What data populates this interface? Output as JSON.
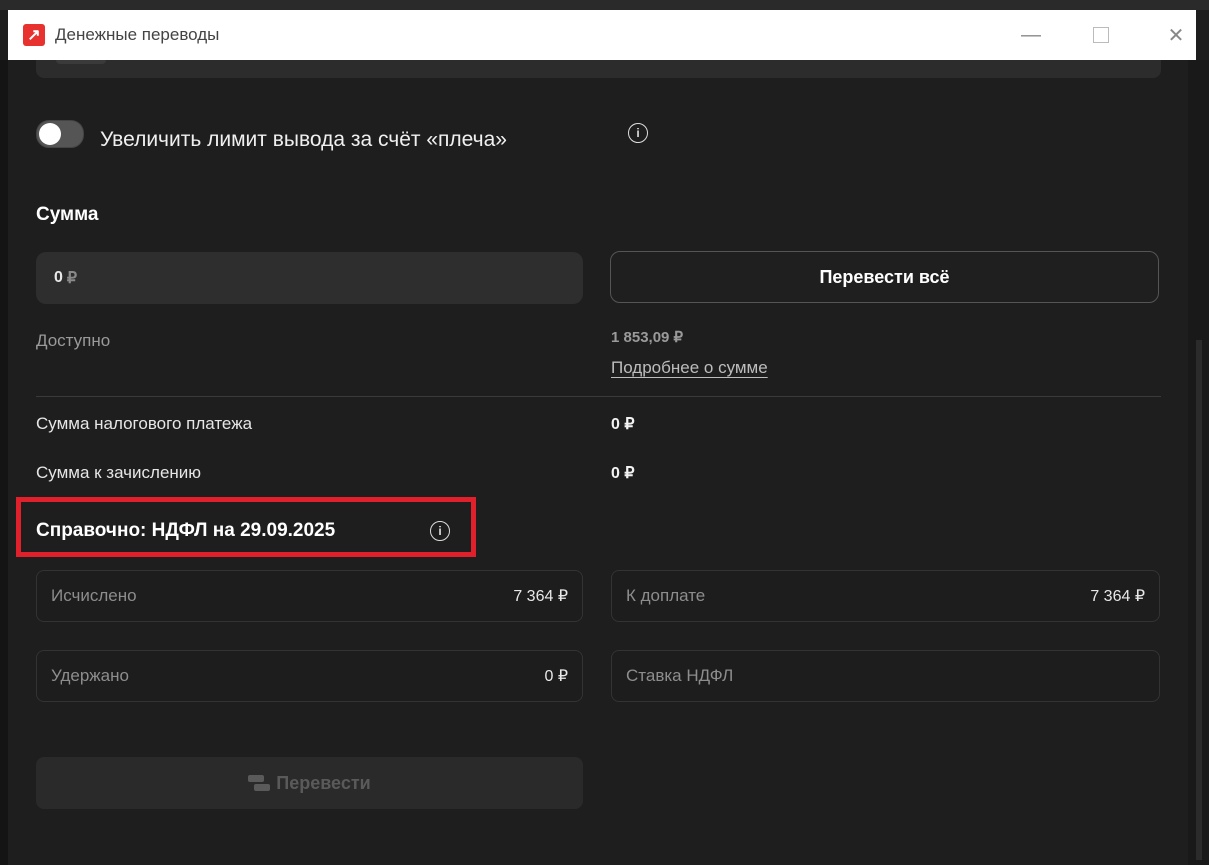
{
  "window": {
    "title": "Денежные переводы",
    "app_icon": "arrow-logo-icon",
    "controls": {
      "minimize": "—",
      "close": "✕"
    }
  },
  "leverage": {
    "label": "Увеличить лимит вывода за счёт «плеча»",
    "enabled": false,
    "info_icon": "info-icon"
  },
  "amount": {
    "section_title": "Сумма",
    "input_value": "0",
    "currency": "₽",
    "transfer_all_label": "Перевести всё"
  },
  "summary": {
    "available_label": "Доступно",
    "available_value": "1 853,09 ₽",
    "details_link": "Подробнее о сумме",
    "tax_payment_label": "Сумма налогового платежа",
    "tax_payment_value": "0 ₽",
    "credit_label": "Сумма к зачислению",
    "credit_value": "0 ₽"
  },
  "ndfl": {
    "title": "Справочно: НДФЛ на 29.09.2025",
    "calculated_label": "Исчислено",
    "calculated_value": "7 364 ₽",
    "to_pay_label": "К доплате",
    "to_pay_value": "7 364 ₽",
    "withheld_label": "Удержано",
    "withheld_value": "0 ₽",
    "rate_label": "Ставка НДФЛ",
    "rate_value": ""
  },
  "actions": {
    "send_label": "Перевести",
    "send_icon": "transfer-icon"
  },
  "colors": {
    "background": "#1e1e1e",
    "accent_red": "#e8322f",
    "highlight_border": "#e0202a"
  }
}
